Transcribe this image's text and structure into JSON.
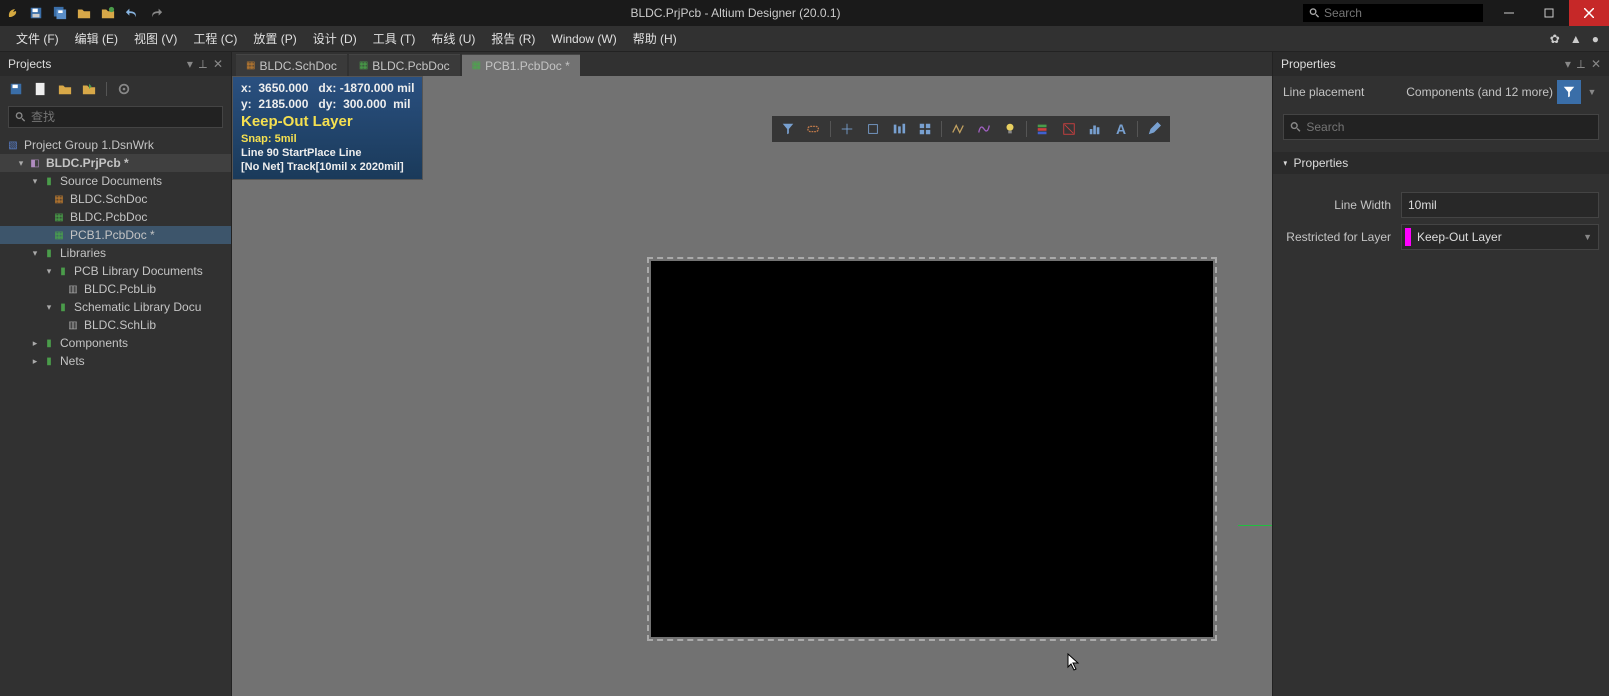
{
  "titlebar": {
    "title": "BLDC.PrjPcb - Altium Designer (20.0.1)",
    "search_placeholder": "Search"
  },
  "menu": [
    "文件 (F)",
    "编辑 (E)",
    "视图 (V)",
    "工程 (C)",
    "放置 (P)",
    "设计 (D)",
    "工具 (T)",
    "布线 (U)",
    "报告 (R)",
    "Window (W)",
    "帮助 (H)"
  ],
  "projects": {
    "title": "Projects",
    "search_placeholder": "查找",
    "workgroup": "Project Group 1.DsnWrk",
    "project": "BLDC.PrjPcb *",
    "source_docs_label": "Source Documents",
    "docs": [
      "BLDC.SchDoc",
      "BLDC.PcbDoc",
      "PCB1.PcbDoc *"
    ],
    "libraries_label": "Libraries",
    "pcb_lib_docs_label": "PCB Library Documents",
    "pcb_lib": "BLDC.PcbLib",
    "sch_lib_docs_label": "Schematic Library Docu",
    "sch_lib": "BLDC.SchLib",
    "components_label": "Components",
    "nets_label": "Nets"
  },
  "tabs": [
    {
      "label": "BLDC.SchDoc",
      "active": false,
      "icon": "sch"
    },
    {
      "label": "BLDC.PcbDoc",
      "active": false,
      "icon": "pcb"
    },
    {
      "label": "PCB1.PcbDoc *",
      "active": true,
      "icon": "pcb"
    }
  ],
  "hud": {
    "x": "3650.000",
    "dx": "-1870.000",
    "y": "2185.000",
    "dy": "300.000",
    "unit": "mil",
    "layer": "Keep-Out Layer",
    "snap": "Snap: 5mil",
    "line1": "Line 90 StartPlace Line",
    "line2": "[No Net] Track[10mil x 2020mil]"
  },
  "properties": {
    "title": "Properties",
    "mode": "Line placement",
    "filter": "Components (and 12 more)",
    "search_placeholder": "Search",
    "section": "Properties",
    "line_width_label": "Line Width",
    "line_width": "10mil",
    "restricted_label": "Restricted for Layer",
    "restricted_value": "Keep-Out Layer"
  }
}
